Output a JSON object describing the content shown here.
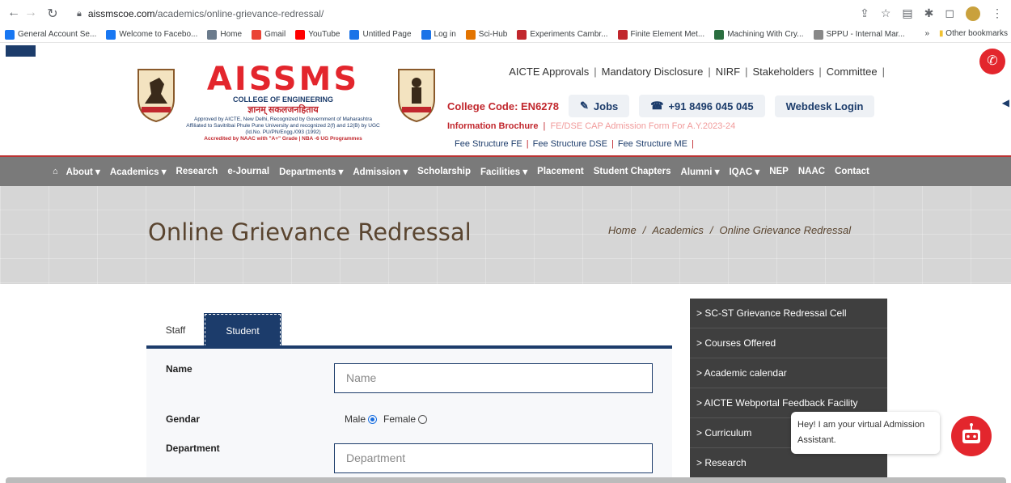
{
  "browser": {
    "url_host": "aissmscoe.com",
    "url_path": "/academics/online-grievance-redressal/",
    "bookmarks": [
      {
        "label": "General Account Se...",
        "color": "#1877f2"
      },
      {
        "label": "Welcome to Facebo...",
        "color": "#1877f2"
      },
      {
        "label": "Home",
        "color": "#6b7b8c"
      },
      {
        "label": "Gmail",
        "color": "#ea4335"
      },
      {
        "label": "YouTube",
        "color": "#ff0000"
      },
      {
        "label": "Untitled Page",
        "color": "#1a73e8"
      },
      {
        "label": "Log in",
        "color": "#1a73e8"
      },
      {
        "label": "Sci-Hub",
        "color": "#e37400"
      },
      {
        "label": "Experiments Cambr...",
        "color": "#c1272d"
      },
      {
        "label": "Finite Element Met...",
        "color": "#c1272d"
      },
      {
        "label": "Machining With Cry...",
        "color": "#2a6e3f"
      },
      {
        "label": "SPPU - Internal Mar...",
        "color": "#888888"
      }
    ],
    "more_bookmarks": "»",
    "other_bookmarks": "Other bookmarks"
  },
  "header": {
    "brand_name": "AISSMS",
    "college_name": "COLLEGE OF ENGINEERING",
    "motto": "ज्ञानम् सकलजनहिताय",
    "approval_line1": "Approved by AICTE, New Delhi, Recognized by Government of Maharashtra",
    "approval_line2": "Affiliated to Savitribai Phule Pune University and recognized 2(f) and 12(B) by UGC",
    "approval_line3": "(Id.No. PU/PN/Engg./093 (1992)",
    "accreditation": "Accredited by NAAC with \"A+\" Grade | NBA -6 UG Programmes",
    "top_links": [
      "AICTE Approvals",
      "Mandatory Disclosure",
      "NIRF",
      "Stakeholders",
      "Committee"
    ],
    "college_code": "College Code: EN6278",
    "jobs_label": "Jobs",
    "phone_label": "+91 8496 045 045",
    "webdesk_label": "Webdesk Login",
    "info_brochure": "Information Brochure",
    "cap_form": "FE/DSE CAP Admission Form For A.Y.2023-24",
    "fee_links": [
      "Fee Structure FE",
      "Fee Structure DSE",
      "Fee Structure ME"
    ]
  },
  "nav": {
    "items": [
      "About",
      "Academics",
      "Research",
      "e-Journal",
      "Departments",
      "Admission",
      "Scholarship",
      "Facilities",
      "Placement",
      "Student Chapters",
      "Alumni",
      "IQAC",
      "NEP",
      "NAAC",
      "Contact"
    ]
  },
  "banner": {
    "title": "Online Grievance Redressal",
    "crumbs": [
      "Home",
      "Academics",
      "Online Grievance Redressal"
    ]
  },
  "form": {
    "tabs": [
      "Staff",
      "Student"
    ],
    "active_tab": "Student",
    "name_label": "Name",
    "name_placeholder": "Name",
    "gender_label": "Gendar",
    "gender_options": [
      "Male",
      "Female"
    ],
    "gender_selected": "Male",
    "department_label": "Department",
    "department_placeholder": "Department"
  },
  "sidebar": {
    "items": [
      "> SC-ST Grievance Redressal Cell",
      "> Courses Offered",
      "> Academic calendar",
      "> AICTE Webportal Feedback Facility",
      "> Curriculum",
      "> Research"
    ]
  },
  "chat": {
    "message": "Hey! I am your virtual Admission Assistant."
  },
  "colors": {
    "brand_red": "#e3262d",
    "brand_blue": "#1c3c6b",
    "nav_gray": "#7a7a7a",
    "sidebar_dark": "#3f3f3f"
  }
}
